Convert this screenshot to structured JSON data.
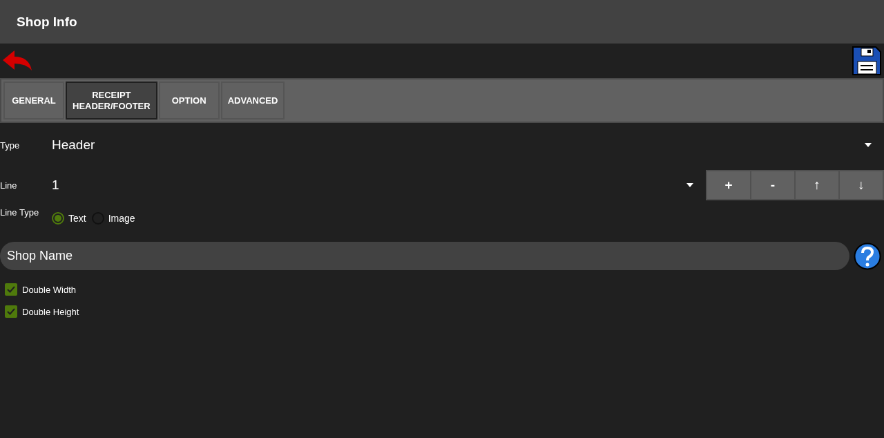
{
  "window": {
    "title": "Shop Info"
  },
  "tabs": [
    {
      "label": "GENERAL",
      "selected": false
    },
    {
      "label": "RECEIPT\nHEADER/FOOTER",
      "selected": true
    },
    {
      "label": "OPTION",
      "selected": false
    },
    {
      "label": "ADVANCED",
      "selected": false
    }
  ],
  "type": {
    "label": "Type",
    "value": "Header"
  },
  "line": {
    "label": "Line",
    "value": "1",
    "buttons": [
      "+",
      "-",
      "↑",
      "↓"
    ]
  },
  "line_type": {
    "label": "Line Type",
    "options": [
      {
        "label": "Text",
        "selected": true
      },
      {
        "label": "Image",
        "selected": false
      }
    ]
  },
  "text_field": {
    "value": "Shop Name"
  },
  "checkboxes": [
    {
      "label": "Double Width",
      "checked": true
    },
    {
      "label": "Double Height",
      "checked": true
    }
  ]
}
